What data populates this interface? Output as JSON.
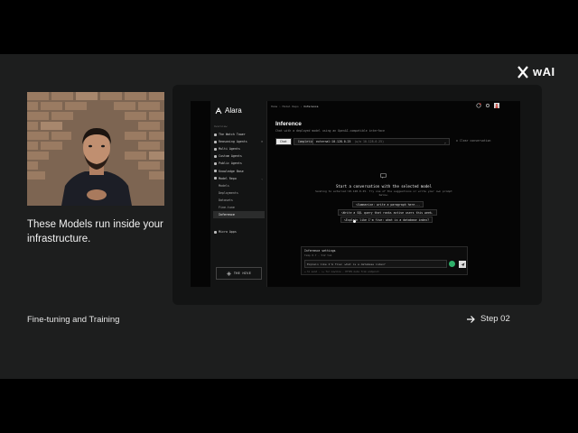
{
  "brand": {
    "name": "wAI"
  },
  "caption": "These Models run inside your infrastructure.",
  "footer": {
    "left": "Fine-tuning and Training",
    "right": "Step 02"
  },
  "app": {
    "logo": "Alara",
    "breadcrumb": {
      "parts": [
        "Home",
        "Model Repo"
      ],
      "current": "Inference"
    },
    "sidebar": {
      "section": "Overview",
      "items": [
        {
          "label": "The Watch Tower",
          "trail": ""
        },
        {
          "label": "Reasoning Agents",
          "trail": "⌘"
        },
        {
          "label": "Multi Agents",
          "trail": ""
        },
        {
          "label": "Custom Agents",
          "trail": ""
        },
        {
          "label": "Public Agents",
          "trail": ""
        },
        {
          "label": "Knowledge Base",
          "trail": ""
        },
        {
          "label": "Model Repo",
          "trail": "⌄"
        }
      ],
      "children": [
        "Models",
        "Deployments",
        "Datasets",
        "Fine-tune",
        "Inference"
      ],
      "active_child": "Inference",
      "micro": "Micro Apps",
      "badge": "THE HIVE"
    },
    "page": {
      "title": "Inference",
      "subtitle": "Chat with a deployed model using an OpenAI-compatible interface"
    },
    "modes": {
      "chat": "Chat",
      "completion": "Completion"
    },
    "model": {
      "value": "external:10.128.0.25",
      "hint": "(w/o 10.128.0.25)"
    },
    "clear": "Clear conversation",
    "empty": {
      "title": "Start a conversation with the selected model",
      "subtitle": "Sending to external:10.128.0.25. Try one of the suggestions or write your own prompt below."
    },
    "suggestions": [
      "Summarize: write a paragraph here...",
      "Write a SQL query that ranks active users this week.",
      "Explain like I'm five: what is a database index?"
    ],
    "composer": {
      "header": "Inference settings",
      "meta": "Temp 0.7 · 512 tok",
      "input": "Explain like I'm five: what is a database index?",
      "footer": "↵ to send · ⇧↵ for newline · HTTPS mode from endpoint"
    }
  }
}
